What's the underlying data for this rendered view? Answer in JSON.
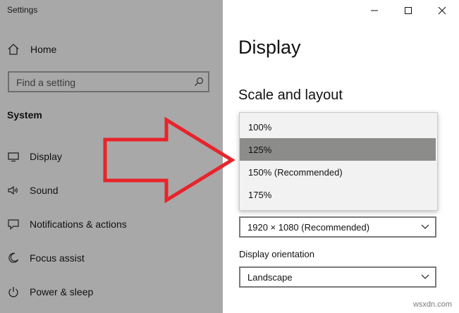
{
  "window": {
    "title": "Settings",
    "controls": [
      "minimize-icon",
      "maximize-icon",
      "close-icon"
    ]
  },
  "sidebar": {
    "home_label": "Home",
    "search": {
      "placeholder": "Find a setting",
      "value": ""
    },
    "section_heading": "System",
    "items": [
      {
        "label": "Display",
        "icon": "monitor-icon"
      },
      {
        "label": "Sound",
        "icon": "speaker-icon"
      },
      {
        "label": "Notifications & actions",
        "icon": "message-icon"
      },
      {
        "label": "Focus assist",
        "icon": "moon-icon"
      },
      {
        "label": "Power & sleep",
        "icon": "power-icon"
      }
    ]
  },
  "main": {
    "page_title": "Display",
    "section_title": "Scale and layout",
    "scale_dropdown": {
      "options": [
        "100%",
        "125%",
        "150% (Recommended)",
        "175%"
      ],
      "highlighted": "125%"
    },
    "resolution_select": {
      "value": "1920 × 1080 (Recommended)"
    },
    "orientation": {
      "label": "Display orientation",
      "value": "Landscape"
    }
  },
  "annotation": {
    "type": "arrow",
    "color": "#e8242a"
  },
  "watermark": "wsxdn.com"
}
